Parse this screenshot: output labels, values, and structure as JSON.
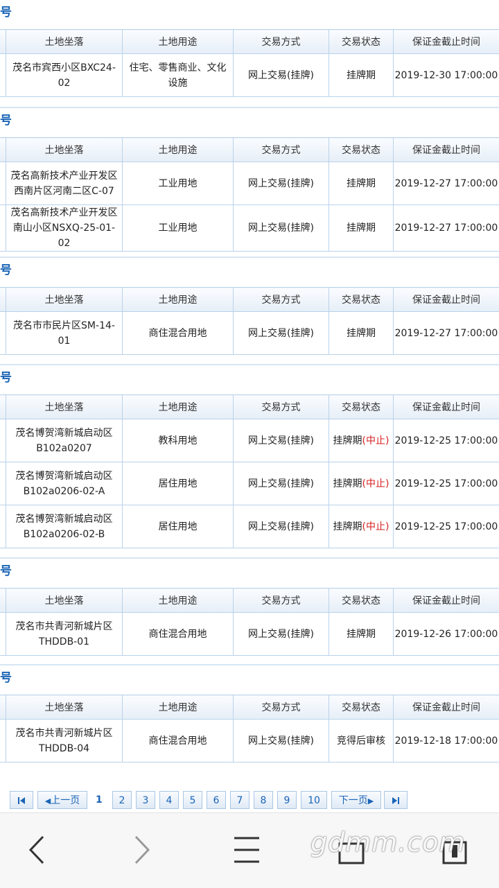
{
  "headers": [
    "土地坐落",
    "土地用途",
    "交易方式",
    "交易状态",
    "保证金截止时间"
  ],
  "sections": [
    {
      "title": "号",
      "rows": [
        {
          "location": "茂名市宾西小区BXC24-02",
          "use": "住宅、零售商业、文化设施",
          "method": "网上交易(挂牌)",
          "status": "挂牌期",
          "status_flag": "",
          "deadline": "2019-12-30 17:00:00"
        }
      ]
    },
    {
      "title": "号",
      "rows": [
        {
          "location": "茂名高新技术产业开发区西南片区河南二区C-07",
          "use": "工业用地",
          "method": "网上交易(挂牌)",
          "status": "挂牌期",
          "status_flag": "",
          "deadline": "2019-12-27 17:00:00"
        },
        {
          "location": "茂名高新技术产业开发区南山小区NSXQ-25-01-02",
          "use": "工业用地",
          "method": "网上交易(挂牌)",
          "status": "挂牌期",
          "status_flag": "",
          "deadline": "2019-12-27 17:00:00"
        }
      ]
    },
    {
      "title": "号",
      "rows": [
        {
          "location": "茂名市市民片区SM-14-01",
          "use": "商住混合用地",
          "method": "网上交易(挂牌)",
          "status": "挂牌期",
          "status_flag": "",
          "deadline": "2019-12-27 17:00:00"
        }
      ]
    },
    {
      "title": "号",
      "rows": [
        {
          "location": "茂名博贺湾新城启动区B102a0207",
          "use": "教科用地",
          "method": "网上交易(挂牌)",
          "status": "挂牌期",
          "status_flag": "(中止)",
          "deadline": "2019-12-25 17:00:00"
        },
        {
          "location": "茂名博贺湾新城启动区B102a0206-02-A",
          "use": "居住用地",
          "method": "网上交易(挂牌)",
          "status": "挂牌期",
          "status_flag": "(中止)",
          "deadline": "2019-12-25 17:00:00"
        },
        {
          "location": "茂名博贺湾新城启动区B102a0206-02-B",
          "use": "居住用地",
          "method": "网上交易(挂牌)",
          "status": "挂牌期",
          "status_flag": "(中止)",
          "deadline": "2019-12-25 17:00:00"
        }
      ]
    },
    {
      "title": "号",
      "rows": [
        {
          "location": "茂名市共青河新城片区THDDB-01",
          "use": "商住混合用地",
          "method": "网上交易(挂牌)",
          "status": "挂牌期",
          "status_flag": "",
          "deadline": "2019-12-26 17:00:00"
        }
      ]
    },
    {
      "title": "号",
      "rows": [
        {
          "location": "茂名市共青河新城片区THDDB-04",
          "use": "商住混合用地",
          "method": "网上交易(挂牌)",
          "status": "竞得后审核",
          "status_flag": "",
          "deadline": "2019-12-18 17:00:00"
        }
      ]
    }
  ],
  "pager": {
    "prev": "上一页",
    "next": "下一页",
    "current": "1",
    "pages": [
      "2",
      "3",
      "4",
      "5",
      "6",
      "7",
      "8",
      "9",
      "10"
    ]
  },
  "watermark": "gdmm.com",
  "colors": {
    "accent": "#1a64b6",
    "border": "#b9d2ea",
    "stop": "#d61e1e"
  },
  "nav_icons": [
    "back-icon",
    "forward-icon",
    "menu-icon",
    "home-icon",
    "tabs-icon"
  ]
}
